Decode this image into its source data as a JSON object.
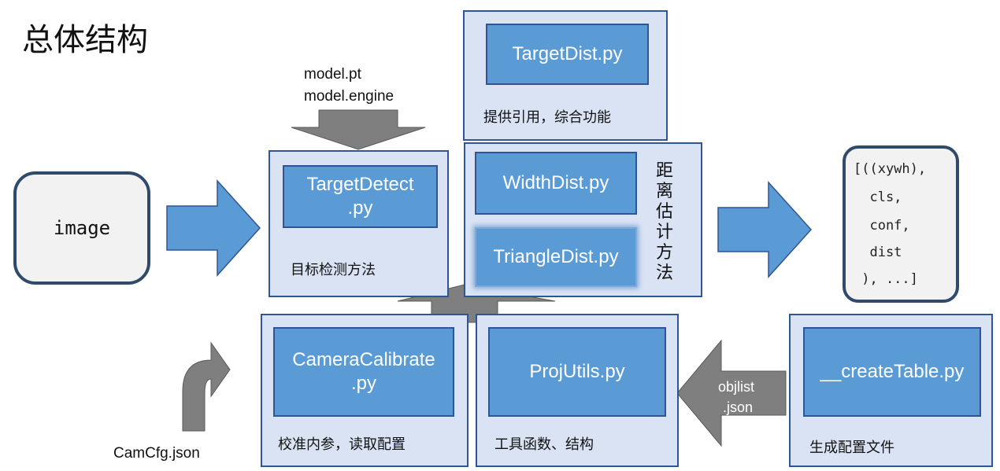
{
  "title": "总体结构",
  "input_box": {
    "label": "image"
  },
  "model_files": {
    "line1": "model.pt",
    "line2": "model.engine"
  },
  "target_dist": {
    "file": "TargetDist.py",
    "caption": "提供引用，综合功能"
  },
  "target_detect": {
    "file": "TargetDetect\n.py",
    "caption": "目标检测方法"
  },
  "distance_methods": {
    "width": "WidthDist.py",
    "triangle": "TriangleDist.py",
    "caption": "距离估计方法"
  },
  "output_box": {
    "lines": [
      "[((xywh),",
      "  cls,",
      "  conf,",
      "  dist",
      " ), ...]"
    ]
  },
  "camera_calibrate": {
    "file": "CameraCalibrate\n.py",
    "caption": "校准内参，读取配置"
  },
  "proj_utils": {
    "file": "ProjUtils.py",
    "caption": "工具函数、结构"
  },
  "create_table": {
    "file": "__createTable.py",
    "caption": "生成配置文件"
  },
  "objlist_label": {
    "line1": "objlist",
    "line2": ".json"
  },
  "camcfg_label": "CamCfg.json",
  "colors": {
    "panel_fill": "#dae3f3",
    "panel_border": "#2f5597",
    "box_fill": "#5b9bd5",
    "arrow_blue": "#5b9bd5",
    "arrow_gray": "#7f7f7f"
  }
}
